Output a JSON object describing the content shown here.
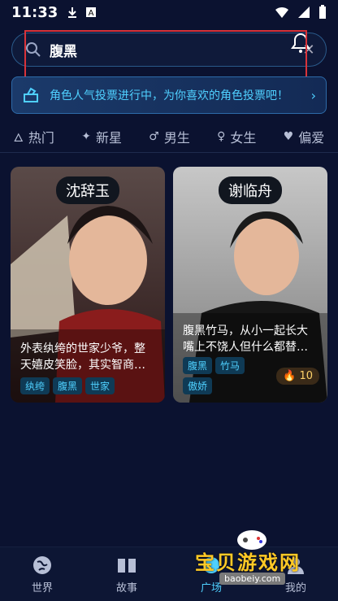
{
  "status": {
    "time": "11:33"
  },
  "search": {
    "value": "腹黑",
    "placeholder": ""
  },
  "banner": {
    "text": "角色人气投票进行中，为你喜欢的角色投票吧！"
  },
  "tabs": [
    {
      "label": "热门",
      "icon": "flame-icon"
    },
    {
      "label": "新星",
      "icon": "sparkle-icon"
    },
    {
      "label": "男生",
      "icon": "male-icon"
    },
    {
      "label": "女生",
      "icon": "female-icon"
    },
    {
      "label": "偏爱",
      "icon": "heart-icon"
    }
  ],
  "cards": [
    {
      "name": "沈辞玉",
      "desc": "外表纨绔的世家少爷，整天嬉皮笑脸，其实智商…",
      "tags": [
        "纨绔",
        "腹黑",
        "世家"
      ],
      "hot": ""
    },
    {
      "name": "谢临舟",
      "desc": "腹黑竹马，从小一起长大嘴上不饶人但什么都替…",
      "tags": [
        "腹黑",
        "竹马",
        "傲娇"
      ],
      "hot": "10"
    }
  ],
  "nav": [
    {
      "label": "世界",
      "icon": "globe-icon"
    },
    {
      "label": "故事",
      "icon": "book-icon"
    },
    {
      "label": "广场",
      "icon": "square-icon"
    },
    {
      "label": "我的",
      "icon": "user-icon"
    }
  ],
  "watermark": {
    "title": "宝贝游戏网",
    "url": "baobeiy.com"
  },
  "colors": {
    "background": "#0b1230",
    "accent": "#4fd0ff",
    "highlight": "#d8333a"
  }
}
